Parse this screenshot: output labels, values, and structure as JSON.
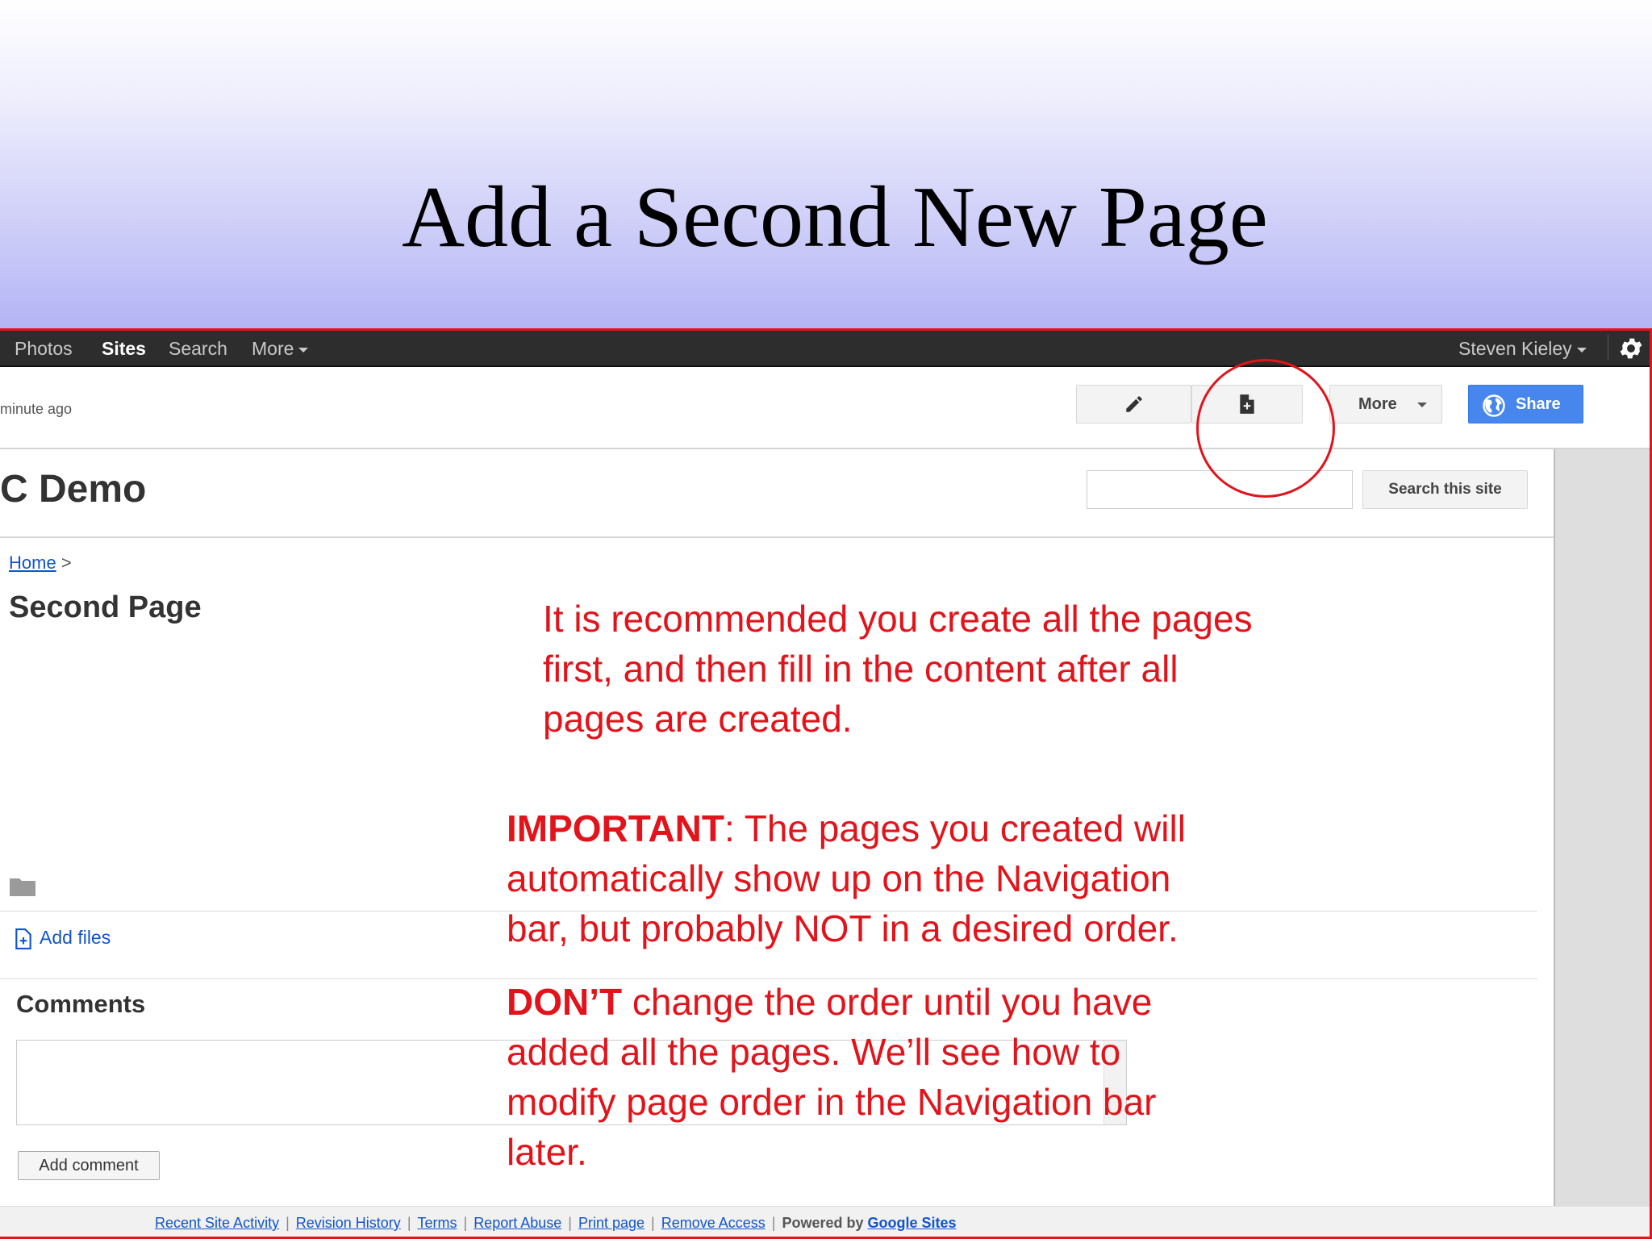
{
  "slide": {
    "title": "Add a Second New Page"
  },
  "gbar": {
    "items": [
      "Photos",
      "Sites",
      "Search",
      "More"
    ],
    "user": "Steven Kieley"
  },
  "toolbar": {
    "edited": "minute ago",
    "edit_icon": "pencil-icon",
    "new_page_icon": "new-page-icon",
    "more_label": "More",
    "share_label": "Share"
  },
  "site": {
    "title": "C Demo",
    "search_value": "",
    "search_button": "Search this site"
  },
  "page": {
    "breadcrumb_home": "Home",
    "breadcrumb_sep": ">",
    "title": "Second Page",
    "add_files": "Add files",
    "comments_heading": "Comments",
    "comment_value": "",
    "add_comment": "Add comment"
  },
  "footer": {
    "links": [
      "Recent Site Activity",
      "Revision History",
      "Terms",
      "Report Abuse",
      "Print page",
      "Remove Access"
    ],
    "powered_by": "Powered by",
    "powered_link": "Google Sites"
  },
  "notes": {
    "recommend": [
      "It is recommended you create all the pages",
      "first, and then fill in the content after all",
      "pages are created."
    ],
    "important_label": "IMPORTANT",
    "important": [
      ": The pages you created will",
      "automatically show up on the Navigation",
      "bar, but probably NOT in a desired order."
    ],
    "dont_label": "DON’T",
    "dont": [
      " change the order until you have",
      "added all the pages. We’ll see how to",
      "modify page order in the Navigation bar",
      "later."
    ]
  },
  "colors": {
    "annotation": "#e1141b",
    "gbar": "#2d2d2d",
    "share": "#4787ed",
    "link": "#1155cc"
  }
}
